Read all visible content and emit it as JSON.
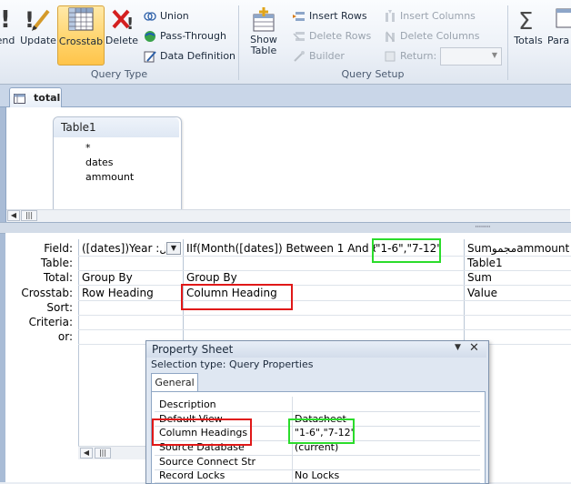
{
  "ribbon": {
    "query_type": {
      "label": "Query Type",
      "buttons": [
        {
          "label": "end"
        },
        {
          "label": "Update"
        },
        {
          "label": "Crosstab",
          "selected": true
        },
        {
          "label": "Delete"
        }
      ],
      "small": [
        {
          "label": "Union"
        },
        {
          "label": "Pass-Through"
        },
        {
          "label": "Data Definition"
        }
      ]
    },
    "query_setup": {
      "label": "Query Setup",
      "show_table": "Show\nTable",
      "show_table_l1": "Show",
      "show_table_l2": "Table",
      "col1": [
        {
          "label": "Insert Rows",
          "enabled": true
        },
        {
          "label": "Delete Rows",
          "enabled": false
        },
        {
          "label": "Builder",
          "enabled": false
        }
      ],
      "col2": [
        {
          "label": "Insert Columns",
          "enabled": false
        },
        {
          "label": "Delete Columns",
          "enabled": false
        },
        {
          "label": "Return:",
          "enabled": false
        }
      ]
    },
    "totals": "Totals",
    "params": "Para"
  },
  "document_tab": "total",
  "table_box": {
    "title": "Table1",
    "fields": [
      "*",
      "dates",
      "ammount"
    ]
  },
  "grid": {
    "row_labels": [
      "Field:",
      "Table:",
      "Total:",
      "Crosstab:",
      "Sort:",
      "Criteria:",
      "or:"
    ],
    "columns": [
      {
        "field": "([dates])Year :أل",
        "table": "",
        "total": "Group By",
        "crosstab": "Row Heading"
      },
      {
        "field": "IIf(Month([dates]) Between 1 And 6",
        "field_highlight": "\"1-6\",\"7-12\"",
        "table": "",
        "total": "Group By",
        "crosstab": "Column Heading"
      },
      {
        "field": "Sumمجموammount: ar",
        "table": "Table1",
        "total": "Sum",
        "crosstab": "Value"
      }
    ]
  },
  "property_sheet": {
    "title": "Property Sheet",
    "selection_type": "Selection type:  Query Properties",
    "tab": "General",
    "rows": [
      {
        "name": "Description",
        "value": ""
      },
      {
        "name": "Default View",
        "value": "Datasheet"
      },
      {
        "name": "Column Headings",
        "value": "\"1-6\",\"7-12\""
      },
      {
        "name": "Source Database",
        "value": "(current)"
      },
      {
        "name": "Source Connect Str",
        "value": ""
      },
      {
        "name": "Record Locks",
        "value": "No Locks"
      }
    ]
  },
  "colors": {
    "highlight_red": "#e01818",
    "highlight_green": "#2bdc2b",
    "selected_button": "#ffd36a"
  }
}
